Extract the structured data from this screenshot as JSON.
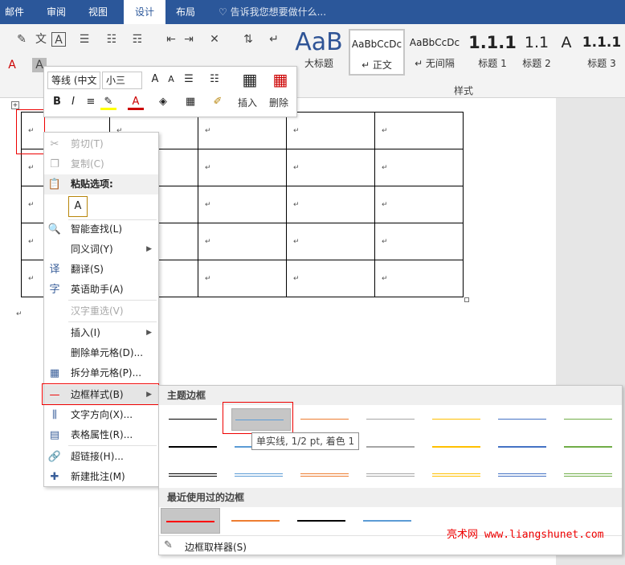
{
  "tabs": [
    "邮件",
    "审阅",
    "视图",
    "设计",
    "布局"
  ],
  "active_tab": "设计",
  "tell_me": "告诉我您想要做什么...",
  "styles": {
    "gallery": [
      {
        "preview": "AaB",
        "label": "大标题"
      },
      {
        "preview": "AaBbCcDc",
        "label": "↵ 正文"
      },
      {
        "preview": "AaBbCcDc",
        "label": "↵ 无间隔"
      },
      {
        "preview": "1.1.1",
        "label": "标题 1"
      },
      {
        "preview": "1.1",
        "label": "标题 2"
      },
      {
        "preview": "A",
        "label": "标题 2"
      },
      {
        "preview": "1.1.1",
        "label": "标题 3"
      }
    ],
    "group_label": "样式"
  },
  "mini_toolbar": {
    "font_name": "等线 (中文",
    "font_size": "小三",
    "bold": "B",
    "italic": "I",
    "insert_label": "插入",
    "delete_label": "删除"
  },
  "paragraph_mark": "↵",
  "context_menu": {
    "items": [
      {
        "label": "剪切(T)",
        "disabled": true,
        "icon": "scissors-icon"
      },
      {
        "label": "复制(C)",
        "disabled": true,
        "icon": "copy-icon"
      },
      {
        "label": "粘贴选项:",
        "header": true,
        "icon": "paste-icon"
      },
      {
        "label": "智能查找(L)",
        "icon": "search-icon"
      },
      {
        "label": "同义词(Y)",
        "submenu": true
      },
      {
        "label": "翻译(S)",
        "icon": "translate-icon"
      },
      {
        "label": "英语助手(A)",
        "icon": "english-assistant-icon"
      },
      {
        "label": "汉字重选(V)",
        "disabled": true
      },
      {
        "label": "插入(I)",
        "submenu": true
      },
      {
        "label": "删除单元格(D)..."
      },
      {
        "label": "拆分单元格(P)...",
        "icon": "split-cells-icon"
      },
      {
        "label": "边框样式(B)",
        "submenu": true,
        "highlighted": true,
        "icon": "border-style-icon"
      },
      {
        "label": "文字方向(X)...",
        "icon": "text-direction-icon"
      },
      {
        "label": "表格属性(R)...",
        "icon": "table-properties-icon"
      },
      {
        "label": "超链接(H)...",
        "icon": "hyperlink-icon"
      },
      {
        "label": "新建批注(M)",
        "icon": "new-comment-icon"
      }
    ]
  },
  "border_submenu": {
    "theme_heading": "主题边框",
    "recent_heading": "最近使用过的边框",
    "tooltip": "单实线, 1/2 pt, 着色 1",
    "painter_label": "边框取样器(S)",
    "colors": [
      "#000000",
      "#5b9bd5",
      "#ed7d31",
      "#a5a5a5",
      "#ffc000",
      "#4472c4",
      "#70ad47"
    ],
    "recent_colors": [
      "#ff0000",
      "#ed7d31",
      "#000000",
      "#5b9bd5"
    ]
  },
  "watermark": "亮术网 www.liangshunet.com"
}
